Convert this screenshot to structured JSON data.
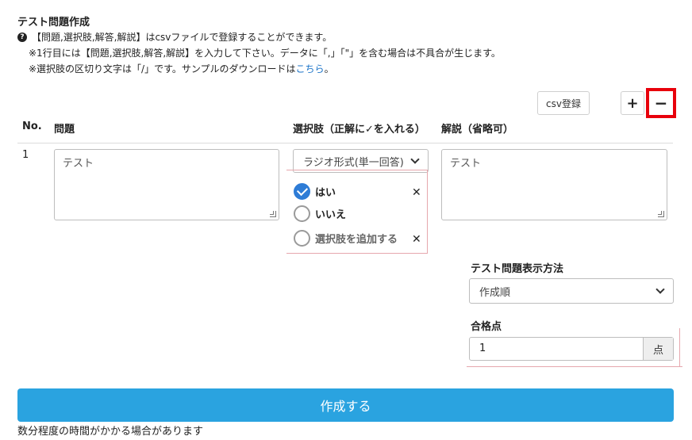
{
  "page": {
    "title": "テスト問題作成",
    "note1": "【問題,選択肢,解答,解説】はcsvファイルで登録することができます。",
    "note2": "※1行目には【問題,選択肢,解答,解説】を入力して下さい。データに「,」「\"」を含む場合は不具合が生じます。",
    "note3_prefix": "※選択肢の区切り文字は「/」です。サンプルのダウンロードは",
    "note3_link": "こちら",
    "note3_suffix": "。"
  },
  "toolbar": {
    "csv_label": "csv登録",
    "add_label": "+",
    "remove_label": "−"
  },
  "table": {
    "headers": {
      "no": "No.",
      "question": "問題",
      "choices": "選択肢（正解に✓を入れる）",
      "explanation": "解説（省略可）"
    },
    "rows": [
      {
        "no": "1",
        "question": "テスト",
        "choice_type": "ラジオ形式(単一回答)",
        "choices": [
          {
            "label": "はい",
            "checked": true
          },
          {
            "label": "いいえ",
            "checked": false
          }
        ],
        "add_choice_label": "選択肢を追加する",
        "explanation": "テスト"
      }
    ]
  },
  "settings": {
    "display_method_label": "テスト問題表示方法",
    "display_method_value": "作成順",
    "pass_score_label": "合格点",
    "pass_score_value": "1",
    "pass_score_unit": "点"
  },
  "submit": {
    "label": "作成する",
    "note": "数分程度の時間がかかる場合があります"
  },
  "colors": {
    "primary": "#2aa3e0",
    "checked": "#2e7cd6",
    "highlight": "#e8000b",
    "link": "#1a73c8"
  },
  "icons": [
    "question-circle-icon",
    "check-icon",
    "close-icon",
    "chevron-down-icon",
    "resize-handle-icon"
  ]
}
